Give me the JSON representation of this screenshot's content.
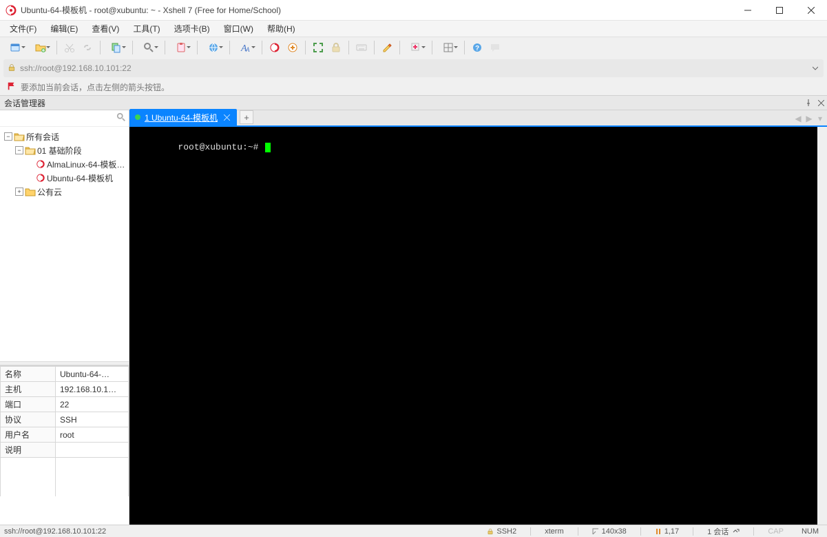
{
  "window": {
    "title": "Ubuntu-64-模板机 - root@xubuntu: ~ - Xshell 7 (Free for Home/School)"
  },
  "menu": {
    "file": "文件(F)",
    "edit": "编辑(E)",
    "view": "查看(V)",
    "tools": "工具(T)",
    "tabs": "选项卡(B)",
    "window": "窗口(W)",
    "help": "帮助(H)"
  },
  "address": {
    "url": "ssh://root@192.168.10.101:22"
  },
  "hint": {
    "text": "要添加当前会话，点击左侧的箭头按钮。"
  },
  "sidebar": {
    "title": "会话管理器",
    "search_placeholder": "",
    "tree": {
      "root": "所有会话",
      "grp1": "01 基础阶段",
      "host1": "AlmaLinux-64-模板…",
      "host2": "Ubuntu-64-模板机",
      "grp2": "公有云"
    },
    "props": {
      "name_k": "名称",
      "name_v": "Ubuntu-64-…",
      "host_k": "主机",
      "host_v": "192.168.10.1…",
      "port_k": "端口",
      "port_v": "22",
      "proto_k": "协议",
      "proto_v": "SSH",
      "user_k": "用户名",
      "user_v": "root",
      "desc_k": "说明",
      "desc_v": ""
    }
  },
  "tab": {
    "label": "1 Ubuntu-64-模板机",
    "status_color": "#39d353"
  },
  "terminal": {
    "prompt": "root@xubuntu:~# "
  },
  "status": {
    "conn": "ssh://root@192.168.10.101:22",
    "proto": "SSH2",
    "term": "xterm",
    "size": "140x38",
    "cursor": "1,17",
    "sessions": "1 会话",
    "cap": "CAP",
    "num": "NUM"
  },
  "colors": {
    "accent": "#0a84ff",
    "tab_dot": "#39d353",
    "cursor": "#00ff00"
  }
}
